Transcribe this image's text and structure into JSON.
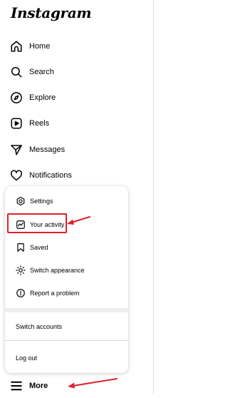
{
  "app": {
    "logo_text": "Instagram"
  },
  "sidebar": {
    "items": [
      {
        "label": "Home",
        "icon": "home-icon"
      },
      {
        "label": "Search",
        "icon": "search-icon"
      },
      {
        "label": "Explore",
        "icon": "compass-icon"
      },
      {
        "label": "Reels",
        "icon": "reels-icon"
      },
      {
        "label": "Messages",
        "icon": "paper-plane-icon"
      },
      {
        "label": "Notifications",
        "icon": "heart-icon"
      }
    ],
    "more": {
      "label": "More",
      "icon": "hamburger-menu-icon"
    }
  },
  "more_menu": {
    "items": [
      {
        "label": "Settings",
        "icon": "gear-icon"
      },
      {
        "label": "Your activity",
        "icon": "activity-icon"
      },
      {
        "label": "Saved",
        "icon": "bookmark-icon"
      },
      {
        "label": "Switch appearance",
        "icon": "sun-icon"
      },
      {
        "label": "Report a problem",
        "icon": "report-icon"
      }
    ],
    "switch_accounts": "Switch accounts",
    "log_out": "Log out"
  },
  "annotations": {
    "highlight_color": "#e0202a"
  }
}
